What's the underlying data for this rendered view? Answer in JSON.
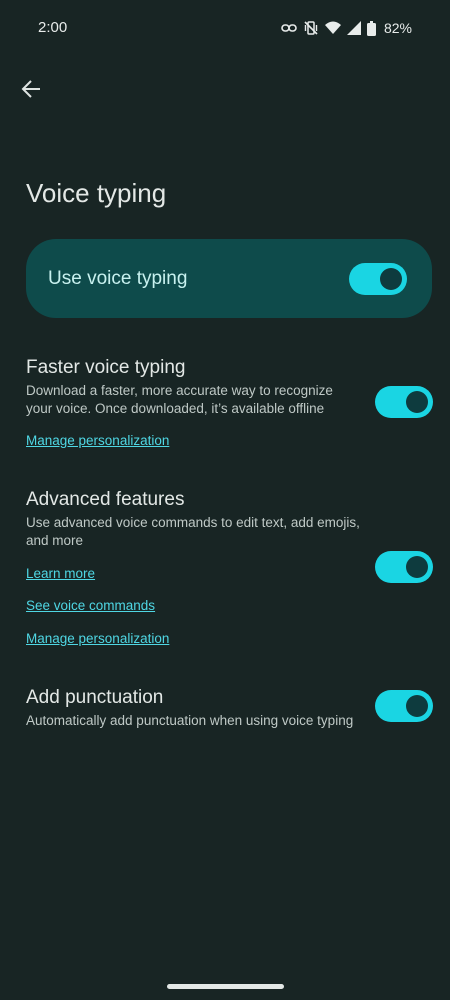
{
  "status_bar": {
    "time": "2:00",
    "battery_percent": "82%",
    "icons": [
      "link-icon",
      "vibrate-off-icon",
      "wifi-icon",
      "signal-icon",
      "battery-icon"
    ]
  },
  "header": {
    "back_icon": "arrow-left-icon",
    "title": "Voice typing"
  },
  "master_toggle": {
    "label": "Use voice typing",
    "enabled": true
  },
  "sections": {
    "faster": {
      "title": "Faster voice typing",
      "description": "Download a faster, more accurate way to recognize your voice. Once downloaded, it’s available offline",
      "enabled": true,
      "links": [
        "Manage personalization"
      ]
    },
    "advanced": {
      "title": "Advanced features",
      "description": "Use advanced voice commands to edit text, add emojis, and more",
      "enabled": true,
      "links": [
        "Learn more",
        "See voice commands",
        "Manage personalization"
      ]
    },
    "punctuation": {
      "title": "Add punctuation",
      "description": "Automatically add punctuation when using voice typing",
      "enabled": true
    }
  },
  "colors": {
    "background": "#182524",
    "card": "#0e4b4b",
    "accent": "#1ad5e3",
    "link": "#4fd7e4"
  }
}
